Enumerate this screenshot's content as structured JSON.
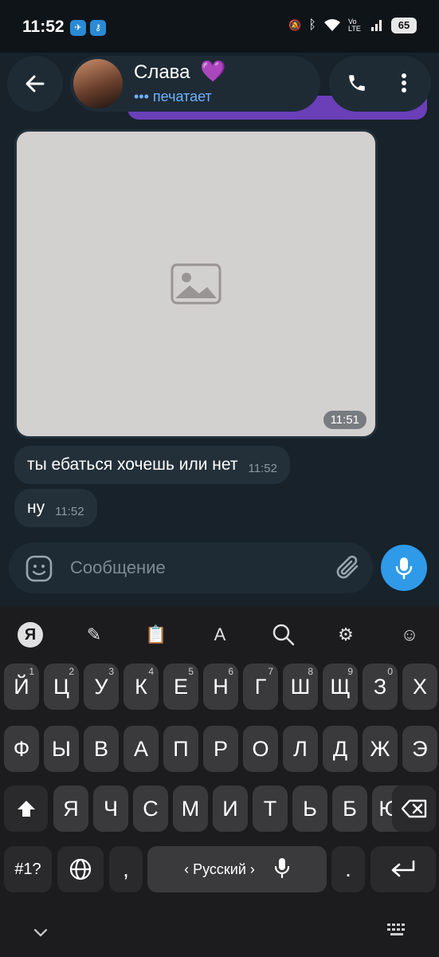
{
  "status_bar": {
    "time": "11:52",
    "app_icons": [
      "telegram-icon",
      "vpn-key-icon"
    ],
    "right_icons": [
      "mute-icon",
      "bluetooth-icon",
      "wifi-icon",
      "volte-icon",
      "signal-icon"
    ],
    "volte": "Vo LTE",
    "battery": "65"
  },
  "header": {
    "contact_name": "Слава",
    "contact_emoji": "💜",
    "status": "••• печатает"
  },
  "messages": [
    {
      "type": "image",
      "time": "11:51"
    },
    {
      "type": "text",
      "text": "ты ебаться хочешь или нет",
      "time": "11:52"
    },
    {
      "type": "text",
      "text": "ну",
      "time": "11:52"
    }
  ],
  "input": {
    "placeholder": "Сообщение",
    "value": ""
  },
  "keyboard": {
    "toolbar": [
      "yandex-icon",
      "magic-wand-icon",
      "clipboard-icon",
      "translate-icon",
      "search-icon",
      "settings-icon",
      "emoji-icon"
    ],
    "row1": [
      {
        "k": "Й",
        "h": "1"
      },
      {
        "k": "Ц",
        "h": "2"
      },
      {
        "k": "У",
        "h": "3"
      },
      {
        "k": "К",
        "h": "4"
      },
      {
        "k": "Е",
        "h": "5"
      },
      {
        "k": "Н",
        "h": "6"
      },
      {
        "k": "Г",
        "h": "7"
      },
      {
        "k": "Ш",
        "h": "8"
      },
      {
        "k": "Щ",
        "h": "9"
      },
      {
        "k": "З",
        "h": "0"
      },
      {
        "k": "Х",
        "h": ""
      }
    ],
    "row2": [
      "Ф",
      "Ы",
      "В",
      "А",
      "П",
      "Р",
      "О",
      "Л",
      "Д",
      "Ж",
      "Э"
    ],
    "row3": [
      "Я",
      "Ч",
      "С",
      "М",
      "И",
      "Т",
      "Ь",
      "Б",
      "Ю"
    ],
    "symbols_key": "#1?",
    "comma_key": ",",
    "space_label": "‹ Русский ›",
    "period_key": "."
  },
  "colors": {
    "accent": "#2f9ae8",
    "bubble_in": "#233039",
    "bubble_out": "#6a3fb8",
    "typing": "#6fb1ff"
  }
}
